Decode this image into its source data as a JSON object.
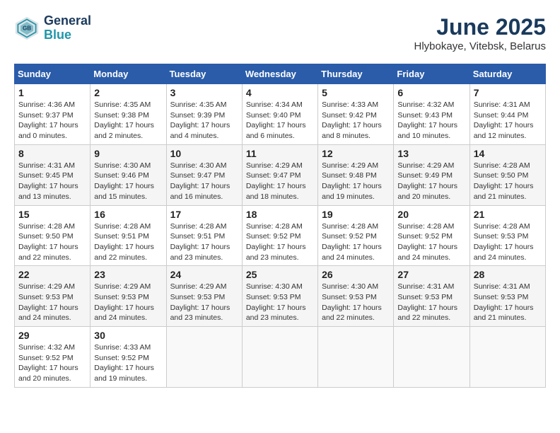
{
  "header": {
    "logo_line1": "General",
    "logo_line2": "Blue",
    "month_year": "June 2025",
    "location": "Hlybokaye, Vitebsk, Belarus"
  },
  "weekdays": [
    "Sunday",
    "Monday",
    "Tuesday",
    "Wednesday",
    "Thursday",
    "Friday",
    "Saturday"
  ],
  "weeks": [
    [
      {
        "day": "1",
        "info": "Sunrise: 4:36 AM\nSunset: 9:37 PM\nDaylight: 17 hours\nand 0 minutes."
      },
      {
        "day": "2",
        "info": "Sunrise: 4:35 AM\nSunset: 9:38 PM\nDaylight: 17 hours\nand 2 minutes."
      },
      {
        "day": "3",
        "info": "Sunrise: 4:35 AM\nSunset: 9:39 PM\nDaylight: 17 hours\nand 4 minutes."
      },
      {
        "day": "4",
        "info": "Sunrise: 4:34 AM\nSunset: 9:40 PM\nDaylight: 17 hours\nand 6 minutes."
      },
      {
        "day": "5",
        "info": "Sunrise: 4:33 AM\nSunset: 9:42 PM\nDaylight: 17 hours\nand 8 minutes."
      },
      {
        "day": "6",
        "info": "Sunrise: 4:32 AM\nSunset: 9:43 PM\nDaylight: 17 hours\nand 10 minutes."
      },
      {
        "day": "7",
        "info": "Sunrise: 4:31 AM\nSunset: 9:44 PM\nDaylight: 17 hours\nand 12 minutes."
      }
    ],
    [
      {
        "day": "8",
        "info": "Sunrise: 4:31 AM\nSunset: 9:45 PM\nDaylight: 17 hours\nand 13 minutes."
      },
      {
        "day": "9",
        "info": "Sunrise: 4:30 AM\nSunset: 9:46 PM\nDaylight: 17 hours\nand 15 minutes."
      },
      {
        "day": "10",
        "info": "Sunrise: 4:30 AM\nSunset: 9:47 PM\nDaylight: 17 hours\nand 16 minutes."
      },
      {
        "day": "11",
        "info": "Sunrise: 4:29 AM\nSunset: 9:47 PM\nDaylight: 17 hours\nand 18 minutes."
      },
      {
        "day": "12",
        "info": "Sunrise: 4:29 AM\nSunset: 9:48 PM\nDaylight: 17 hours\nand 19 minutes."
      },
      {
        "day": "13",
        "info": "Sunrise: 4:29 AM\nSunset: 9:49 PM\nDaylight: 17 hours\nand 20 minutes."
      },
      {
        "day": "14",
        "info": "Sunrise: 4:28 AM\nSunset: 9:50 PM\nDaylight: 17 hours\nand 21 minutes."
      }
    ],
    [
      {
        "day": "15",
        "info": "Sunrise: 4:28 AM\nSunset: 9:50 PM\nDaylight: 17 hours\nand 22 minutes."
      },
      {
        "day": "16",
        "info": "Sunrise: 4:28 AM\nSunset: 9:51 PM\nDaylight: 17 hours\nand 22 minutes."
      },
      {
        "day": "17",
        "info": "Sunrise: 4:28 AM\nSunset: 9:51 PM\nDaylight: 17 hours\nand 23 minutes."
      },
      {
        "day": "18",
        "info": "Sunrise: 4:28 AM\nSunset: 9:52 PM\nDaylight: 17 hours\nand 23 minutes."
      },
      {
        "day": "19",
        "info": "Sunrise: 4:28 AM\nSunset: 9:52 PM\nDaylight: 17 hours\nand 24 minutes."
      },
      {
        "day": "20",
        "info": "Sunrise: 4:28 AM\nSunset: 9:52 PM\nDaylight: 17 hours\nand 24 minutes."
      },
      {
        "day": "21",
        "info": "Sunrise: 4:28 AM\nSunset: 9:53 PM\nDaylight: 17 hours\nand 24 minutes."
      }
    ],
    [
      {
        "day": "22",
        "info": "Sunrise: 4:29 AM\nSunset: 9:53 PM\nDaylight: 17 hours\nand 24 minutes."
      },
      {
        "day": "23",
        "info": "Sunrise: 4:29 AM\nSunset: 9:53 PM\nDaylight: 17 hours\nand 24 minutes."
      },
      {
        "day": "24",
        "info": "Sunrise: 4:29 AM\nSunset: 9:53 PM\nDaylight: 17 hours\nand 23 minutes."
      },
      {
        "day": "25",
        "info": "Sunrise: 4:30 AM\nSunset: 9:53 PM\nDaylight: 17 hours\nand 23 minutes."
      },
      {
        "day": "26",
        "info": "Sunrise: 4:30 AM\nSunset: 9:53 PM\nDaylight: 17 hours\nand 22 minutes."
      },
      {
        "day": "27",
        "info": "Sunrise: 4:31 AM\nSunset: 9:53 PM\nDaylight: 17 hours\nand 22 minutes."
      },
      {
        "day": "28",
        "info": "Sunrise: 4:31 AM\nSunset: 9:53 PM\nDaylight: 17 hours\nand 21 minutes."
      }
    ],
    [
      {
        "day": "29",
        "info": "Sunrise: 4:32 AM\nSunset: 9:52 PM\nDaylight: 17 hours\nand 20 minutes."
      },
      {
        "day": "30",
        "info": "Sunrise: 4:33 AM\nSunset: 9:52 PM\nDaylight: 17 hours\nand 19 minutes."
      },
      {
        "day": "",
        "info": ""
      },
      {
        "day": "",
        "info": ""
      },
      {
        "day": "",
        "info": ""
      },
      {
        "day": "",
        "info": ""
      },
      {
        "day": "",
        "info": ""
      }
    ]
  ]
}
